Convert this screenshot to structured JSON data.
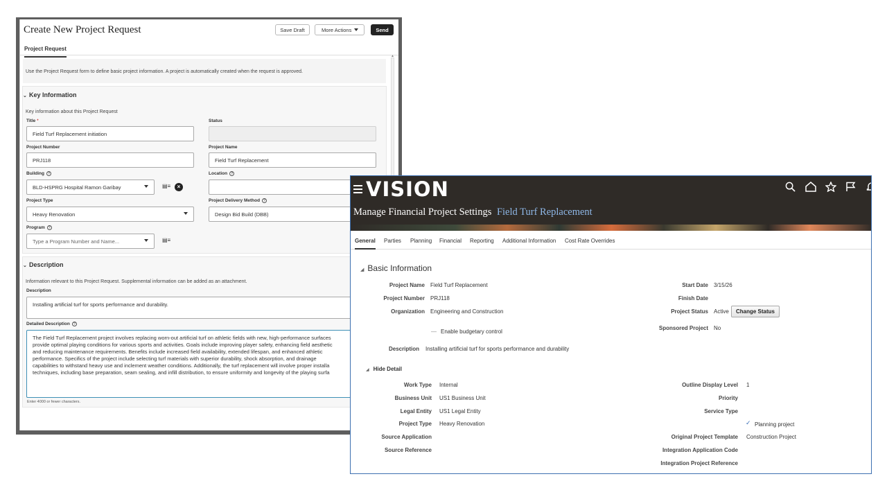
{
  "request_form": {
    "title": "Create New Project Request",
    "buttons": {
      "save_draft": "Save Draft",
      "more_actions": "More Actions",
      "send": "Send"
    },
    "tab": "Project Request",
    "info_text": "Use the Project Request form to define basic project information. A project is automatically created when the request is approved.",
    "key_info": {
      "heading": "Key Information",
      "intro": "Key information about this Project Request",
      "title_label": "Title",
      "title_required": "*",
      "title_value": "Field Turf Replacement initiation",
      "status_label": "Status",
      "status_value": "",
      "project_number_label": "Project Number",
      "project_number_value": "PRJ118",
      "project_name_label": "Project Name",
      "project_name_value": "Field Turf Replacement",
      "building_label": "Building",
      "building_value": "BLD-HSPRG Hospital Ramon Garibay",
      "location_label": "Location",
      "location_value": "",
      "project_type_label": "Project Type",
      "project_type_value": "Heavy Renovation",
      "delivery_method_label": "Project Delivery Method",
      "delivery_method_value": "Design Bid Build (DBB)",
      "program_label": "Program",
      "program_placeholder": "Type a Program Number and Name..."
    },
    "description": {
      "heading": "Description",
      "intro": "Information relevant to this Project Request. Supplemental information can be added as an attachment.",
      "description_label": "Description",
      "description_value": "Installing artificial turf for sports performance and durability.",
      "detailed_label": "Detailed Description",
      "detailed_lines": [
        "The Field Turf Replacement project involves replacing worn-out artificial turf on athletic fields with new, high-performance surfaces",
        "provide optimal playing conditions for various sports and activities. Goals include improving player safety, enhancing field aesthetic",
        "and reducing maintenance requirements. Benefits include increased field availability, extended lifespan, and enhanced athletic",
        "performance. Specifics of the project include selecting turf materials with superior durability, shock absorption, and drainage",
        "capabilities to withstand heavy use and inclement weather conditions. Additionally, the turf replacement will involve proper installa",
        "techniques, including base preparation, seam sealing, and infill distribution, to ensure uniformity and longevity of the playing surfa"
      ],
      "char_hint": "Enter 4000 or fewer characters."
    }
  },
  "settings": {
    "logo": "VISION",
    "header_icons": [
      "search-icon",
      "home-icon",
      "star-icon",
      "flag-icon",
      "bell-icon"
    ],
    "page_title": "Manage Financial Project Settings",
    "project_name_title": "Field Turf Replacement",
    "tabs": [
      "General",
      "Parties",
      "Planning",
      "Financial",
      "Reporting",
      "Additional Information",
      "Cost Rate Overrides"
    ],
    "basic": {
      "heading": "Basic Information",
      "project_name_label": "Project Name",
      "project_name": "Field Turf Replacement",
      "project_number_label": "Project Number",
      "project_number": "PRJ118",
      "organization_label": "Organization",
      "organization": "Engineering and Construction",
      "budgetary_control": "Enable budgetary control",
      "description_label": "Description",
      "description": "Installing artificial turf for sports performance and durability",
      "start_date_label": "Start Date",
      "start_date": "3/15/26",
      "finish_date_label": "Finish Date",
      "finish_date": "",
      "status_label": "Project Status",
      "status": "Active",
      "change_status": "Change Status",
      "sponsored_label": "Sponsored Project",
      "sponsored": "No"
    },
    "detail": {
      "toggle": "Hide Detail",
      "work_type_label": "Work Type",
      "work_type": "Internal",
      "business_unit_label": "Business Unit",
      "business_unit": "US1 Business Unit",
      "legal_entity_label": "Legal Entity",
      "legal_entity": "US1 Legal Entity",
      "project_type_label": "Project Type",
      "project_type": "Heavy Renovation",
      "source_app_label": "Source Application",
      "source_app": "",
      "source_ref_label": "Source Reference",
      "source_ref": "",
      "outline_label": "Outline Display Level",
      "outline": "1",
      "priority_label": "Priority",
      "priority": "",
      "service_type_label": "Service Type",
      "service_type": "",
      "planning_project": "Planning project",
      "template_label": "Original Project Template",
      "template": "Construction Project",
      "int_app_label": "Integration Application Code",
      "int_app": "",
      "int_ref_label": "Integration Project Reference",
      "int_ref": ""
    }
  }
}
